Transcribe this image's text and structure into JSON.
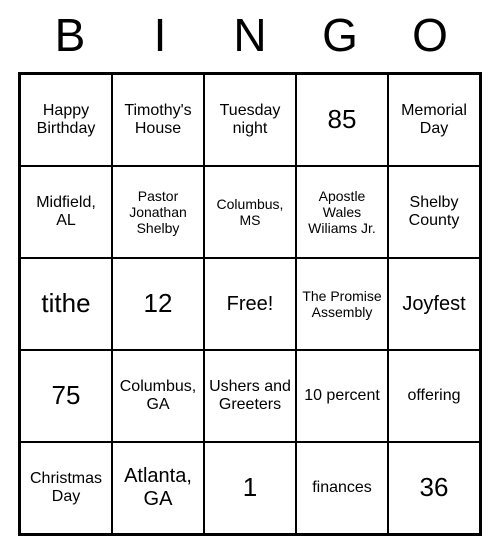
{
  "header": {
    "letters": [
      "B",
      "I",
      "N",
      "G",
      "O"
    ]
  },
  "grid": {
    "rows": [
      [
        {
          "text": "Happy Birthday",
          "size": "normal"
        },
        {
          "text": "Timothy's House",
          "size": "normal"
        },
        {
          "text": "Tuesday night",
          "size": "normal"
        },
        {
          "text": "85",
          "size": "big"
        },
        {
          "text": "Memorial Day",
          "size": "normal"
        }
      ],
      [
        {
          "text": "Midfield, AL",
          "size": "normal"
        },
        {
          "text": "Pastor Jonathan Shelby",
          "size": "small"
        },
        {
          "text": "Columbus, MS",
          "size": "small"
        },
        {
          "text": "Apostle Wales Wiliams Jr.",
          "size": "small"
        },
        {
          "text": "Shelby County",
          "size": "normal"
        }
      ],
      [
        {
          "text": "tithe",
          "size": "big"
        },
        {
          "text": "12",
          "size": "big"
        },
        {
          "text": "Free!",
          "size": "med"
        },
        {
          "text": "The Promise Assembly",
          "size": "small"
        },
        {
          "text": "Joyfest",
          "size": "med"
        }
      ],
      [
        {
          "text": "75",
          "size": "big"
        },
        {
          "text": "Columbus, GA",
          "size": "normal"
        },
        {
          "text": "Ushers and Greeters",
          "size": "normal"
        },
        {
          "text": "10 percent",
          "size": "normal"
        },
        {
          "text": "offering",
          "size": "normal"
        }
      ],
      [
        {
          "text": "Christmas Day",
          "size": "normal"
        },
        {
          "text": "Atlanta, GA",
          "size": "med"
        },
        {
          "text": "1",
          "size": "big"
        },
        {
          "text": "finances",
          "size": "normal"
        },
        {
          "text": "36",
          "size": "big"
        }
      ]
    ]
  }
}
